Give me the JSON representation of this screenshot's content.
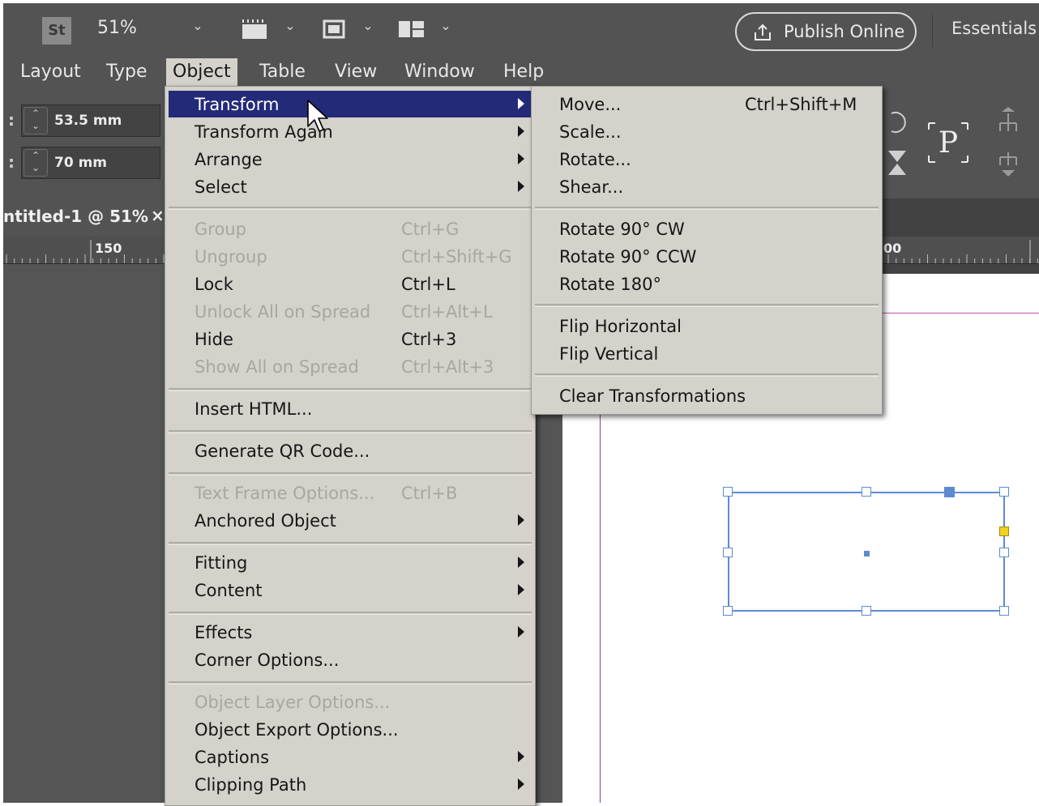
{
  "appbar": {
    "st_label": "St",
    "zoom": "51%",
    "publish_label": "Publish Online",
    "workspace": "Essentials",
    "icons": [
      "chevron-down-icon",
      "frame-icon",
      "screen-mode-icon",
      "arrange-documents-icon",
      "share-icon"
    ]
  },
  "menubar": {
    "items": [
      {
        "label": "Layout"
      },
      {
        "label": "Type"
      },
      {
        "label": "Object",
        "active": true
      },
      {
        "label": "Table"
      },
      {
        "label": "View"
      },
      {
        "label": "Window"
      },
      {
        "label": "Help"
      }
    ]
  },
  "control": {
    "width_value": "53.5 mm",
    "height_value": "70 mm",
    "paragraph_glyph": "P"
  },
  "document": {
    "tab_title": "ntitled-1 @ 51%",
    "close_glyph": "×",
    "ruler_left": "150",
    "ruler_right": "00"
  },
  "object_menu": {
    "items": [
      {
        "label": "Transform",
        "shortcut": "",
        "submenu": true,
        "disabled": false,
        "highlighted": true
      },
      {
        "label": "Transform Again",
        "shortcut": "",
        "submenu": true,
        "disabled": false
      },
      {
        "label": "Arrange",
        "shortcut": "",
        "submenu": true,
        "disabled": false
      },
      {
        "label": "Select",
        "shortcut": "",
        "submenu": true,
        "disabled": false
      },
      {
        "label": "Group",
        "shortcut": "Ctrl+G",
        "submenu": false,
        "disabled": true
      },
      {
        "label": "Ungroup",
        "shortcut": "Ctrl+Shift+G",
        "submenu": false,
        "disabled": true
      },
      {
        "label": "Lock",
        "shortcut": "Ctrl+L",
        "submenu": false,
        "disabled": false
      },
      {
        "label": "Unlock All on Spread",
        "shortcut": "Ctrl+Alt+L",
        "submenu": false,
        "disabled": true
      },
      {
        "label": "Hide",
        "shortcut": "Ctrl+3",
        "submenu": false,
        "disabled": false
      },
      {
        "label": "Show All on Spread",
        "shortcut": "Ctrl+Alt+3",
        "submenu": false,
        "disabled": true
      },
      {
        "label": "Insert HTML...",
        "shortcut": "",
        "submenu": false,
        "disabled": false
      },
      {
        "label": "Generate QR Code...",
        "shortcut": "",
        "submenu": false,
        "disabled": false
      },
      {
        "label": "Text Frame Options...",
        "shortcut": "Ctrl+B",
        "submenu": false,
        "disabled": true
      },
      {
        "label": "Anchored Object",
        "shortcut": "",
        "submenu": true,
        "disabled": false
      },
      {
        "label": "Fitting",
        "shortcut": "",
        "submenu": true,
        "disabled": false
      },
      {
        "label": "Content",
        "shortcut": "",
        "submenu": true,
        "disabled": false
      },
      {
        "label": "Effects",
        "shortcut": "",
        "submenu": true,
        "disabled": false
      },
      {
        "label": "Corner Options...",
        "shortcut": "",
        "submenu": false,
        "disabled": false
      },
      {
        "label": "Object Layer Options...",
        "shortcut": "",
        "submenu": false,
        "disabled": true
      },
      {
        "label": "Object Export Options...",
        "shortcut": "",
        "submenu": false,
        "disabled": false
      },
      {
        "label": "Captions",
        "shortcut": "",
        "submenu": true,
        "disabled": false
      },
      {
        "label": "Clipping Path",
        "shortcut": "",
        "submenu": true,
        "disabled": false
      }
    ]
  },
  "transform_submenu": {
    "items": [
      {
        "label": "Move...",
        "shortcut": "Ctrl+Shift+M"
      },
      {
        "label": "Scale...",
        "shortcut": ""
      },
      {
        "label": "Rotate...",
        "shortcut": ""
      },
      {
        "label": "Shear...",
        "shortcut": ""
      },
      {
        "label": "Rotate 90° CW",
        "shortcut": ""
      },
      {
        "label": "Rotate 90° CCW",
        "shortcut": ""
      },
      {
        "label": "Rotate 180°",
        "shortcut": ""
      },
      {
        "label": "Flip Horizontal",
        "shortcut": ""
      },
      {
        "label": "Flip Vertical",
        "shortcut": ""
      },
      {
        "label": "Clear Transformations",
        "shortcut": ""
      }
    ]
  },
  "colors": {
    "ui_dark": "#535353",
    "menu_bg": "#d5d2cb",
    "menu_highlight": "#232a78",
    "selection_blue": "#5d8bd3",
    "margin_magenta": "#c04fb0",
    "handle_yellow": "#f2d21c"
  }
}
